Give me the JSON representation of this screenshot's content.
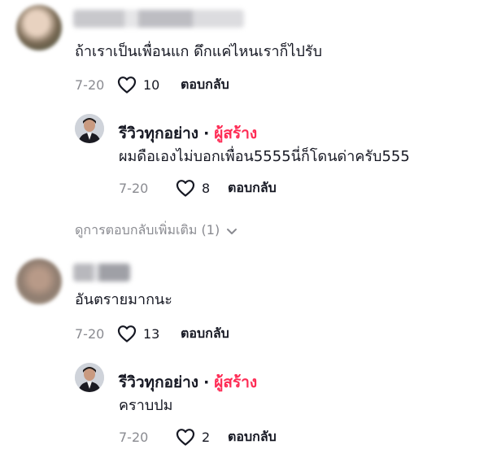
{
  "comments": [
    {
      "text": "ถ้าเราเป็นเพื่อนแก ดึกแค่ไหนเราก็ไปรับ",
      "date": "7-20",
      "likes": "10",
      "reply_label": "ตอบกลับ",
      "replies": [
        {
          "author": "รีวิวทุกอย่าง",
          "separator": "·",
          "badge": "ผู้สร้าง",
          "text": "ผมดือเองไม่บอกเพื่อน5555นี่ก็โดนด่าครับ555",
          "date": "7-20",
          "likes": "8",
          "reply_label": "ตอบกลับ"
        }
      ],
      "view_more": "ดูการตอบกลับเพิ่มเติม (1)"
    },
    {
      "text": "อันตรายมากนะ",
      "date": "7-20",
      "likes": "13",
      "reply_label": "ตอบกลับ",
      "replies": [
        {
          "author": "รีวิวทุกอย่าง",
          "separator": "·",
          "badge": "ผู้สร้าง",
          "text": "คราบปม",
          "date": "7-20",
          "likes": "2",
          "reply_label": "ตอบกลับ"
        }
      ]
    }
  ],
  "icons": {
    "like": "heart-outline-icon",
    "chevron": "chevron-down-icon"
  },
  "colors": {
    "creator_badge": "#fe2c55",
    "meta_gray": "#8a8b91",
    "text": "#161823"
  }
}
